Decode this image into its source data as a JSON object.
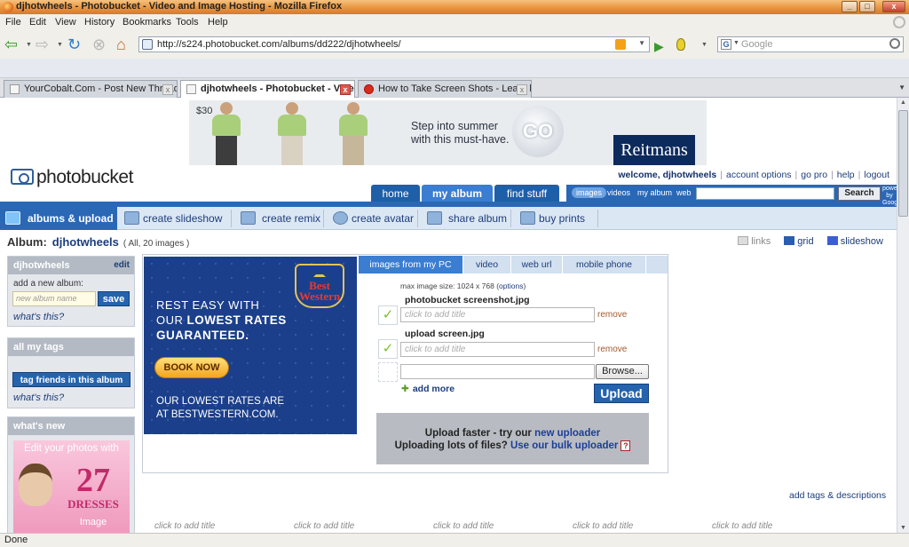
{
  "window": {
    "title": "djhotwheels - Photobucket - Video and Image Hosting - Mozilla Firefox",
    "controls": [
      "_",
      "□",
      "x"
    ]
  },
  "menu": [
    "File",
    "Edit",
    "View",
    "History",
    "Bookmarks",
    "Tools",
    "Help"
  ],
  "nav": {
    "url": "http://s224.photobucket.com/albums/dd222/djhotwheels/",
    "search_placeholder": "Google"
  },
  "tabs": [
    {
      "label": "YourCobalt.Com - Post New Thread",
      "active": false
    },
    {
      "label": "djhotwheels - Photobucket - Vide...",
      "active": true
    },
    {
      "label": "How to Take Screen Shots - Learn h...",
      "active": false
    }
  ],
  "banner": {
    "price": "$30",
    "slogan_line1": "Step into summer",
    "slogan_line2": "with this must-have.",
    "go": "GO",
    "brand": "Reitmans"
  },
  "header": {
    "logo": "photobucket",
    "welcome": "welcome, djhotwheels",
    "links": [
      "account options",
      "go pro",
      "help",
      "logout"
    ],
    "main_tabs": [
      "home",
      "my album",
      "find stuff"
    ],
    "search_scopes": [
      "images",
      "videos",
      "my album",
      "web"
    ],
    "search_button": "Search",
    "powered_by": "powered by Google"
  },
  "toolbar": {
    "items": [
      "albums & upload",
      "create slideshow",
      "create remix",
      "create avatar",
      "share album",
      "buy prints"
    ]
  },
  "album": {
    "label": "Album:",
    "name": "djhotwheels",
    "count": "( All, 20 images )",
    "view_options": [
      "links",
      "grid",
      "slideshow"
    ]
  },
  "sidebar": {
    "album_box": {
      "title": "djhotwheels",
      "edit": "edit",
      "add_label": "add a new album:",
      "placeholder": "new album name",
      "save": "save",
      "help": "what's this?"
    },
    "tags_box": {
      "title": "all my tags",
      "button": "tag friends in this album",
      "help": "what's this?"
    },
    "whats_new": {
      "title": "what's new",
      "promo_line1": "Edit your photos with",
      "promo_number": "27",
      "promo_word": "DRESSES",
      "promo_footer": "Image"
    }
  },
  "ad": {
    "line1": "REST EASY WITH",
    "line2_prefix": "OUR ",
    "line2_bold": "LOWEST RATES",
    "line3": "GUARANTEED.",
    "book": "BOOK NOW",
    "line4": "OUR LOWEST RATES ARE",
    "line5": "AT BESTWESTERN.COM.",
    "logo": "Best Western"
  },
  "upload": {
    "tabs": [
      "images from my PC",
      "video",
      "web url",
      "mobile phone"
    ],
    "max_size": "max image size: 1024 x 768 (",
    "max_size_options": "options",
    "max_size_end": ")",
    "files": [
      {
        "name": "photobucket screenshot.jpg",
        "title_placeholder": "click to add title",
        "remove": "remove"
      },
      {
        "name": "upload screen.jpg",
        "title_placeholder": "click to add title",
        "remove": "remove"
      }
    ],
    "browse": "Browse...",
    "add_more": "add more",
    "upload_button": "Upload",
    "faster_prefix": "Upload faster - try our ",
    "faster_link": "new uploader",
    "bulk_prefix": "Uploading lots of files? ",
    "bulk_link": "Use our bulk uploader",
    "help": "?"
  },
  "gallery": {
    "add_tags": "add tags & descriptions",
    "titles": [
      "click to add title",
      "click to add title",
      "click to add title",
      "click to add title",
      "click to add title"
    ]
  },
  "status": "Done"
}
